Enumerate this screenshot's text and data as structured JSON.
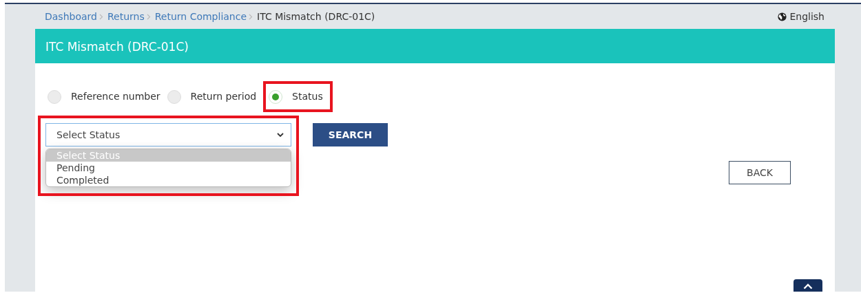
{
  "breadcrumb": [
    {
      "label": "Dashboard",
      "link": true
    },
    {
      "label": "Returns",
      "link": true
    },
    {
      "label": "Return Compliance",
      "link": true
    },
    {
      "label": "ITC Mismatch (DRC-01C)",
      "link": false
    }
  ],
  "language": "English",
  "header": {
    "title": "ITC Mismatch (DRC-01C)"
  },
  "search_by": [
    {
      "label": "Reference number",
      "selected": false,
      "highlighted": false
    },
    {
      "label": "Return period",
      "selected": false,
      "highlighted": false
    },
    {
      "label": "Status",
      "selected": true,
      "highlighted": true
    }
  ],
  "status_select": {
    "value": "Select Status",
    "expanded": true,
    "highlighted": true,
    "options": [
      {
        "label": "Select Status",
        "selected": true
      },
      {
        "label": "Pending",
        "selected": false
      },
      {
        "label": "Completed",
        "selected": false
      }
    ]
  },
  "search_button": "SEARCH",
  "back_button": "BACK"
}
